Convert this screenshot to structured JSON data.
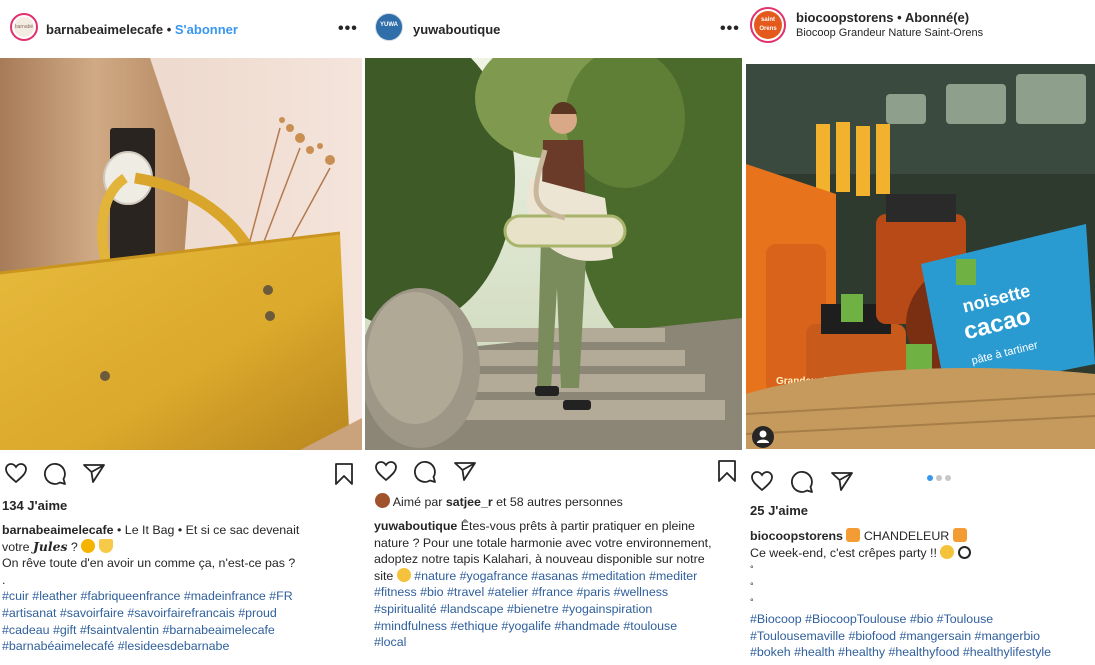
{
  "posts": [
    {
      "username": "barnabeaimelecafe",
      "separator": "•",
      "follow_label": "S'abonner",
      "avatar_text": "barnabé",
      "likes": "134 J'aime",
      "caption": {
        "user": "barnabeaimelecafe",
        "line1": "• Le It Bag • Et si ce sac devenait",
        "line2_prefix": "votre",
        "line2_bold": "Jules",
        "line2_suffix": "?",
        "line3": "On rêve toute d'en avoir un comme ça, n'est-ce pas ?",
        "dot": ".",
        "tags": [
          "#cuir #leather #fabriqueenfrance #madeinfrance #FR",
          "#artisanat #savoirfaire #savoirfairefrancais #proud",
          "#cadeau #gift #fsaintvalentin #barnabeaimelecafe",
          "#barnabéaimelecafé #lesideesdebarnabe"
        ]
      },
      "more_label": "•••"
    },
    {
      "username": "yuwaboutique",
      "avatar_text": "YUWA",
      "more_label": "•••",
      "liked_by": {
        "prefix": "Aimé par",
        "user": "satjee_r",
        "suffix": "et 58 autres personnes"
      },
      "caption": {
        "user": "yuwaboutique",
        "lines": [
          "Êtes-vous prêts à partir pratiquer en pleine",
          "nature ? Pour une totale harmonie avec votre environnement,",
          "adoptez notre tapis Kalahari, à nouveau disponible sur notre",
          "site"
        ],
        "tags": [
          "#nature #yogafrance #asanas #meditation #mediter",
          "#fitness #bio #travel #atelier #france #paris #wellness",
          "#spiritualité #landscape #bienetre #yogainspiration",
          "#mindfulness #ethique #yogalife #handmade #toulouse",
          "#local"
        ]
      }
    },
    {
      "username": "biocoopstorens",
      "separator": "•",
      "status": "Abonné(e)",
      "subtitle": "Biocoop Grandeur Nature Saint-Orens",
      "avatar_text": "saint Orens",
      "likes": "25 J'aime",
      "caption": {
        "user": "biocoopstorens",
        "title": "CHANDELEUR",
        "line2": "Ce week-end, c'est crêpes party !!",
        "dots": [
          "°",
          "°",
          "°"
        ],
        "tags": [
          "#Biocoop #BiocoopToulouse #bio #Toulouse",
          "#Toulousemaville #biofood #mangersain #mangerbio",
          "#bokeh #health #healthy #healthyfood #healthylifestyle"
        ]
      },
      "photo_jar_text": [
        "noisette",
        "cacao",
        "pâte à tartiner",
        "Grandeur Nature"
      ]
    }
  ],
  "colors": {
    "link": "#3897f0",
    "hashtag": "#2f5f9c",
    "bag": "#e1b034"
  }
}
